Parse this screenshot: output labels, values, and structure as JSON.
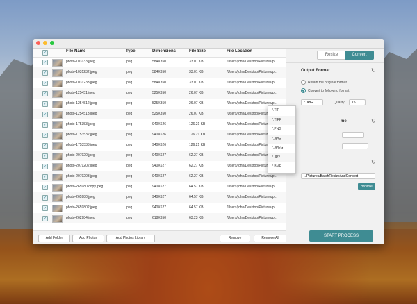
{
  "table": {
    "headers": [
      "File Name",
      "Type",
      "Dimensions",
      "File Size",
      "File Location"
    ],
    "rows": [
      [
        "photo-103133.jpeg",
        "jpeg",
        "584X350",
        "33.01 KB",
        "/Users/john/Desktop/Pictures/p..."
      ],
      [
        "photo-1031232.jpeg",
        "jpeg",
        "584X350",
        "33.01 KB",
        "/Users/john/Desktop/Pictures/p..."
      ],
      [
        "photo-1031233.jpeg",
        "jpeg",
        "584X350",
        "33.01 KB",
        "/Users/john/Desktop/Pictures/p..."
      ],
      [
        "photo-125451.jpeg",
        "jpeg",
        "525X350",
        "26.07 KB",
        "/Users/john/Desktop/Pictures/p..."
      ],
      [
        "photo-1254512.jpeg",
        "jpeg",
        "525X350",
        "26.07 KB",
        "/Users/john/Desktop/Pictures/p..."
      ],
      [
        "photo-1254513.jpeg",
        "jpeg",
        "525X350",
        "26.07 KB",
        "/Users/john/Desktop/Pictures/p..."
      ],
      [
        "photo-175353.jpeg",
        "jpeg",
        "940X626",
        "126.21 KB",
        "/Users/john/Desktop/Pictures/p..."
      ],
      [
        "photo-1753532.jpeg",
        "jpeg",
        "940X626",
        "126.21 KB",
        "/Users/john/Desktop/Pictures/p..."
      ],
      [
        "photo-1753533.jpeg",
        "jpeg",
        "940X626",
        "126.21 KB",
        "/Users/john/Desktop/Pictures/p..."
      ],
      [
        "photo-207920.jpeg",
        "jpeg",
        "940X627",
        "62.27 KB",
        "/Users/john/Desktop/Pictures/p..."
      ],
      [
        "photo-2079202.jpeg",
        "jpeg",
        "940X627",
        "62.27 KB",
        "/Users/john/Desktop/Pictures/p..."
      ],
      [
        "photo-2079203.jpeg",
        "jpeg",
        "940X627",
        "62.27 KB",
        "/Users/john/Desktop/Pictures/p..."
      ],
      [
        "photo-265980 copy.jpeg",
        "jpeg",
        "940X627",
        "64.57 KB",
        "/Users/john/Desktop/Pictures/p..."
      ],
      [
        "photo-265980.jpeg",
        "jpeg",
        "940X627",
        "64.57 KB",
        "/Users/john/Desktop/Pictures/p..."
      ],
      [
        "photo-2659802.jpeg",
        "jpeg",
        "940X627",
        "64.57 KB",
        "/Users/john/Desktop/Pictures/p..."
      ],
      [
        "photo-262984.jpeg",
        "jpeg",
        "618X350",
        "63.23 KB",
        "/Users/john/Desktop/Pictures/p..."
      ]
    ]
  },
  "footer": {
    "add_folder": "Add Folder",
    "add_photos": "Add Photos",
    "add_library": "Add Photos Library",
    "remove": "Remove",
    "remove_all": "Remove All"
  },
  "panel": {
    "tab_resize": "Resize",
    "tab_convert": "Convert",
    "output_format_title": "Output Format",
    "retain_label": "Retain the original format",
    "convert_label": "Convert to following format",
    "format_value": "*.JPG",
    "quality_label": "Quality:",
    "quality_value": "75",
    "section2_partial": "me",
    "path_value": "../Pictures/BatchResizeAndConvert",
    "browse": "Browse",
    "start": "START PROCESS"
  },
  "format_options": [
    "*.TIF",
    "*.TIFF",
    "*.PNG",
    "*.JPG",
    "*.JPEG",
    "*.JP2",
    "*.BMP"
  ],
  "colors": {
    "accent": "#3f8c93"
  },
  "icons": [
    "refresh-icon",
    "checkbox-icon",
    "chevron-down-icon"
  ]
}
